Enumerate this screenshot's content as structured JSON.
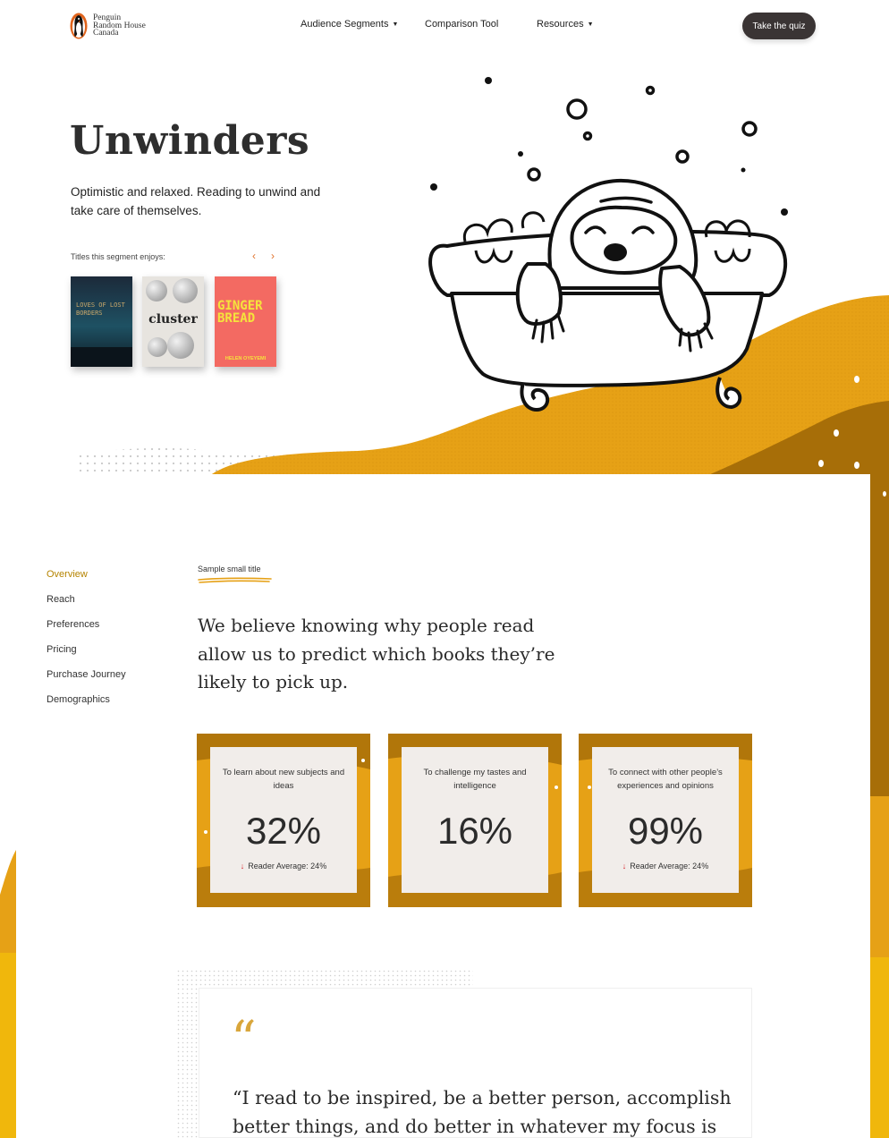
{
  "nav": {
    "brand": [
      "Penguin",
      "Random House",
      "Canada"
    ],
    "links": [
      {
        "label": "Audience Segments",
        "has_caret": true
      },
      {
        "label": "Comparison Tool",
        "has_caret": false
      },
      {
        "label": "Resources",
        "has_caret": true
      }
    ],
    "cta": "Take the quiz"
  },
  "hero": {
    "title": "Unwinders",
    "description": "Optimistic and relaxed. Reading to unwind and take care of themselves.",
    "titles_label": "Titles this segment enjoys:",
    "prev_icon": "‹",
    "next_icon": "›",
    "books": [
      {
        "cover_text": "LOVES OF LOST BORDERS",
        "icon": "book-cover"
      },
      {
        "cover_text": "cluster",
        "icon": "book-cover"
      },
      {
        "cover_text": "GINGER BREAD",
        "author": "HELEN OYEYEMI",
        "icon": "book-cover"
      }
    ]
  },
  "colors": {
    "accent": "#e6a116",
    "dark_accent": "#a76e08",
    "active_link": "#b58400",
    "arrow_down": "#d8232a",
    "button": "#3a3434"
  },
  "subnav": [
    "Overview",
    "Reach",
    "Preferences",
    "Pricing",
    "Purchase Journey",
    "Demographics"
  ],
  "subnav_active": "Overview",
  "section": {
    "small_title": "Sample small title",
    "lead": "We believe knowing why people read allow us to predict which books they’re likely to pick up."
  },
  "stats": [
    {
      "label": "To learn about new subjects and ideas",
      "value": "32%",
      "average": "Reader Average: 24%",
      "arrow": "↓",
      "show_average": true
    },
    {
      "label": "To challenge my tastes and intelligence",
      "value": "16%",
      "average": "",
      "arrow": "",
      "show_average": false
    },
    {
      "label": "To connect with other people’s experiences and opinions",
      "value": "99%",
      "average": "Reader Average: 24%",
      "arrow": "↓",
      "show_average": true
    }
  ],
  "quote": {
    "mark": "“",
    "text": "“I read to be inspired, be a better person, accomplish better things, and do better in whatever my focus is"
  }
}
